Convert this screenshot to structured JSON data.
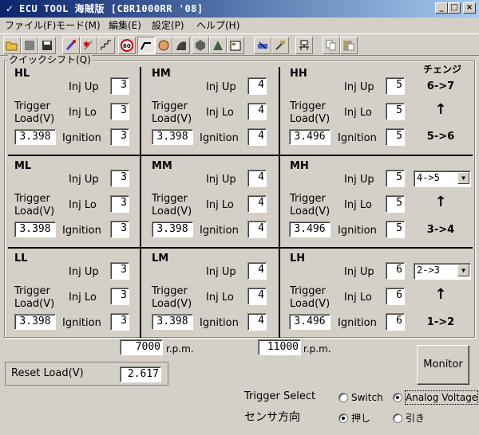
{
  "window": {
    "title": "ECU TOOL 海賊版 [CBR1000RR '08]",
    "controls": {
      "minimize": "_",
      "maximize": "□",
      "close": "×"
    }
  },
  "menu": [
    "ファイル(F)",
    "モード(M)",
    "編集(E)",
    "設定(P)",
    "ヘルプ(H)"
  ],
  "toolbar": {
    "icons": [
      "open-folder-icon",
      "blank-page-icon",
      "save-disk-icon",
      "spark-plug-icon",
      "spark-plug-red-icon",
      "step-chart-icon",
      "speed-limit-icon",
      "quickshift-curve-icon",
      "gauge-icon",
      "fuel-map-icon",
      "hexagon-icon",
      "triangle-icon",
      "settings-sheet-icon",
      "write-ecu-icon",
      "read-ecu-icon",
      "network-icon",
      "copy-icon",
      "paste-icon"
    ],
    "active_index": 7
  },
  "group": {
    "label": "クイックシフト(Q)"
  },
  "labels": {
    "inj_up": "Inj Up",
    "inj_lo": "Inj Lo",
    "ignition": "Ignition",
    "trigger": "Trigger",
    "load": "Load(V)",
    "rpm": "r.p.m."
  },
  "cells": [
    {
      "id": "HL",
      "inj_up": "3",
      "inj_lo": "3",
      "ignition": "3",
      "trigger_load": "3.398"
    },
    {
      "id": "HM",
      "inj_up": "4",
      "inj_lo": "4",
      "ignition": "4",
      "trigger_load": "3.398"
    },
    {
      "id": "HH",
      "inj_up": "5",
      "inj_lo": "5",
      "ignition": "5",
      "trigger_load": "3.496"
    },
    {
      "id": "ML",
      "inj_up": "3",
      "inj_lo": "3",
      "ignition": "3",
      "trigger_load": "3.398"
    },
    {
      "id": "MM",
      "inj_up": "4",
      "inj_lo": "4",
      "ignition": "4",
      "trigger_load": "3.398"
    },
    {
      "id": "MH",
      "inj_up": "5",
      "inj_lo": "5",
      "ignition": "5",
      "trigger_load": "3.496"
    },
    {
      "id": "LL",
      "inj_up": "3",
      "inj_lo": "3",
      "ignition": "3",
      "trigger_load": "3.398"
    },
    {
      "id": "LM",
      "inj_up": "4",
      "inj_lo": "4",
      "ignition": "4",
      "trigger_load": "3.398"
    },
    {
      "id": "LH",
      "inj_up": "6",
      "inj_lo": "6",
      "ignition": "6",
      "trigger_load": "3.496"
    }
  ],
  "change": {
    "header": "チェンジ",
    "top": {
      "from_to_high": "6->7",
      "arrow": "↑",
      "from_to_low": "5->6"
    },
    "mid": {
      "select": "4->5",
      "arrow": "↑",
      "low": "3->4"
    },
    "bot": {
      "select": "2->3",
      "arrow": "↑",
      "low": "1->2"
    }
  },
  "rpm": {
    "low": "7000",
    "high": "11000"
  },
  "reset_load": {
    "label": "Reset Load(V)",
    "value": "2.617"
  },
  "monitor_button": "Monitor",
  "trigger_select": {
    "label": "Trigger Select",
    "options": [
      "Switch",
      "Analog Voltage"
    ],
    "selected": "Analog Voltage"
  },
  "sensor_direction": {
    "label": "センサ方向",
    "options": [
      "押し",
      "引き"
    ],
    "selected": "押し"
  }
}
